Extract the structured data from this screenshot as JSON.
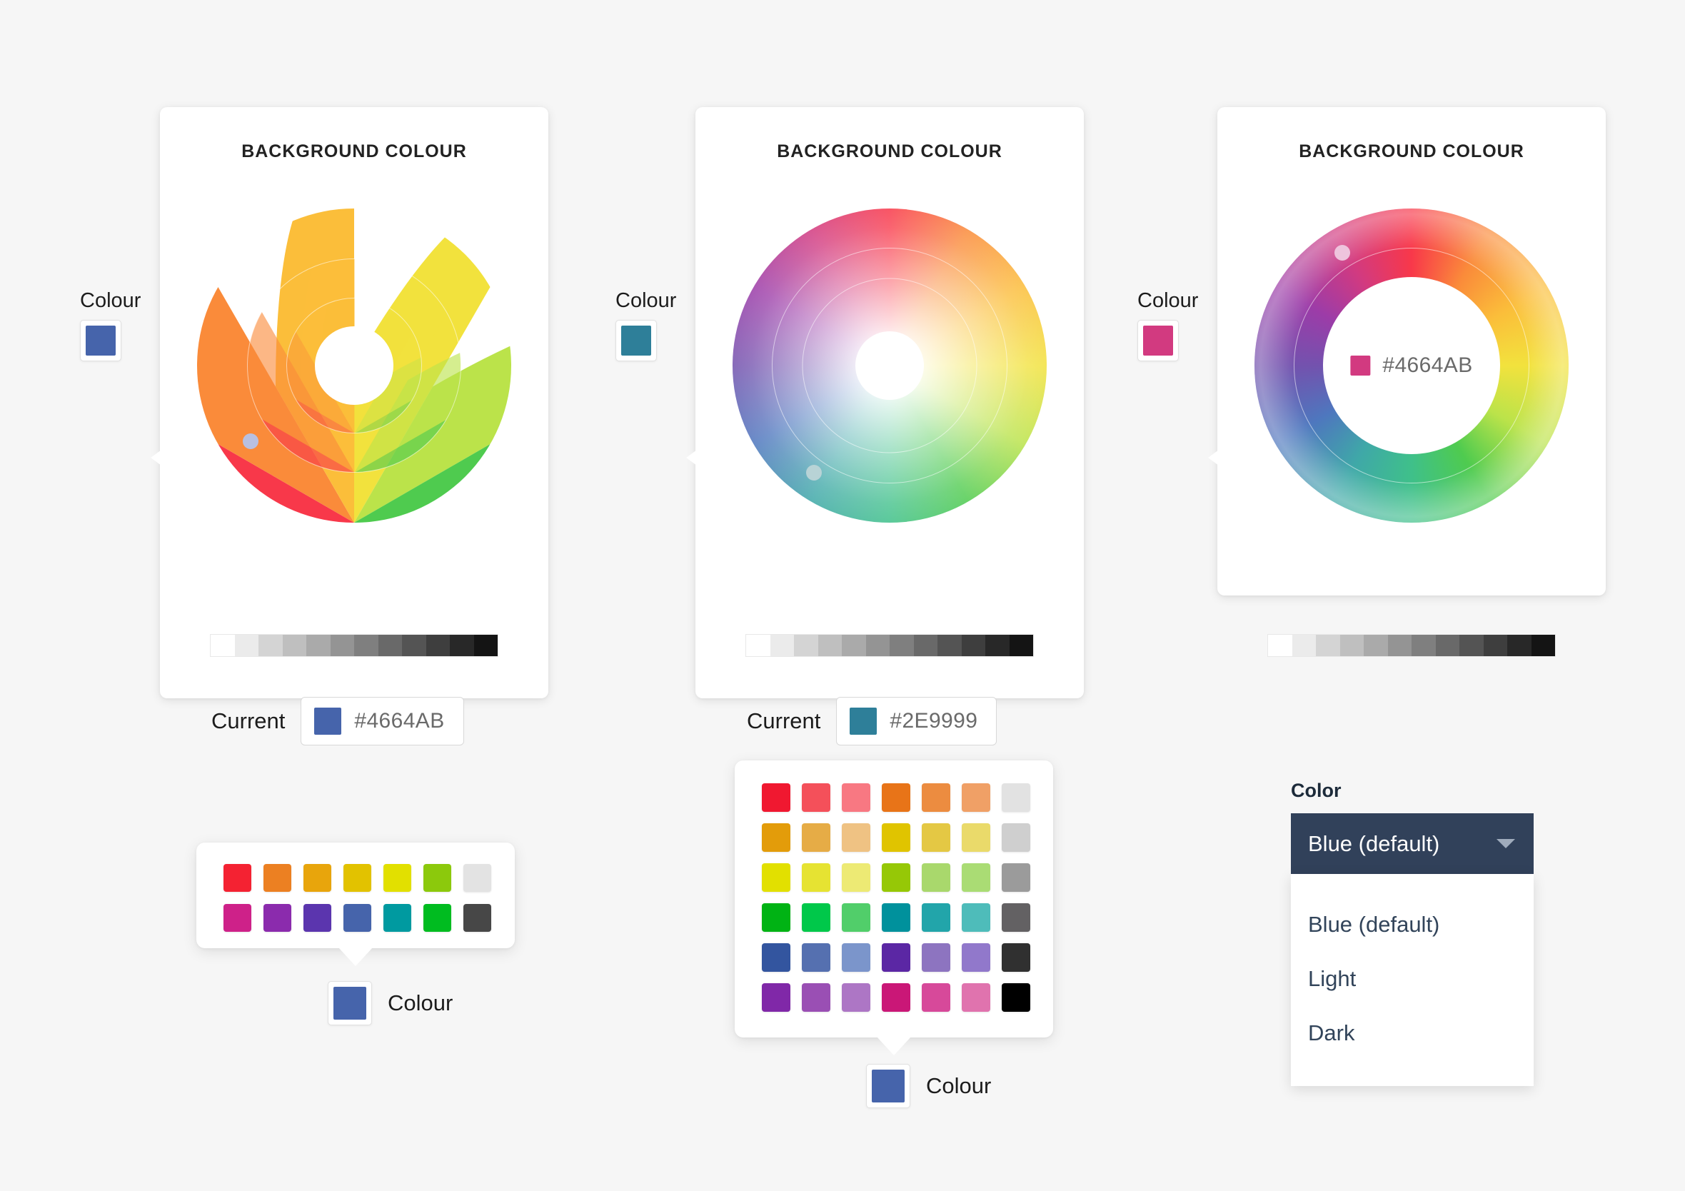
{
  "page": {
    "background": "#f6f6f6"
  },
  "cards": [
    {
      "title": "BACKGROUND COLOUR",
      "wheel_type": "segmented",
      "launcher": {
        "label": "Colour",
        "swatch_color": "#4664AB"
      },
      "selection_dot_color": "#b9c0e0",
      "greyscale": [
        "#ffffff",
        "#ebebeb",
        "#d4d4d4",
        "#bfbfbf",
        "#aaaaaa",
        "#949494",
        "#7f7f7f",
        "#696969",
        "#545454",
        "#3e3e3e",
        "#282828",
        "#141414"
      ],
      "current": {
        "label": "Current",
        "swatch_color": "#4664AB",
        "hex": "#4664AB"
      }
    },
    {
      "title": "BACKGROUND COLOUR",
      "wheel_type": "continuous",
      "launcher": {
        "label": "Colour",
        "swatch_color": "#2E7F99"
      },
      "selection_dot_color": "#b8d3d6",
      "greyscale": [
        "#ffffff",
        "#ebebeb",
        "#d4d4d4",
        "#bfbfbf",
        "#aaaaaa",
        "#949494",
        "#7f7f7f",
        "#696969",
        "#545454",
        "#3e3e3e",
        "#282828",
        "#141414"
      ],
      "current": {
        "label": "Current",
        "swatch_color": "#2E7F99",
        "hex": "#2E9999"
      }
    },
    {
      "title": "BACKGROUND COLOUR",
      "wheel_type": "donut",
      "launcher": {
        "label": "Colour",
        "swatch_color": "#D23A80"
      },
      "selection_dot_color": "#eec4dd",
      "greyscale": [
        "#ffffff",
        "#ebebeb",
        "#d4d4d4",
        "#bfbfbf",
        "#aaaaaa",
        "#949494",
        "#7f7f7f",
        "#696969",
        "#545454",
        "#3e3e3e",
        "#282828",
        "#141414"
      ],
      "center_readout": {
        "swatch_color": "#D23A80",
        "hex": "#4664AB"
      }
    }
  ],
  "small_palette": {
    "columns": 7,
    "rows": 2,
    "colors": [
      "#F42232",
      "#EC8022",
      "#E8A50C",
      "#E2C200",
      "#E2E000",
      "#8CC90C",
      "#E3E3E3",
      "#CE2189",
      "#8B2BAD",
      "#5B35AE",
      "#4664AB",
      "#009AA0",
      "#00BC20",
      "#474747"
    ],
    "anchor": {
      "label": "Colour",
      "swatch_color": "#4664AB"
    }
  },
  "large_palette": {
    "columns": 7,
    "rows": 6,
    "colors": [
      "#F01830",
      "#F4505A",
      "#F87882",
      "#E87418",
      "#EC8C40",
      "#F0A066",
      "#E2E2E2",
      "#E39C0A",
      "#E6AC46",
      "#EFC283",
      "#E0C400",
      "#E4C844",
      "#EADA6A",
      "#CFCFCF",
      "#E2E000",
      "#E6E332",
      "#EDEA74",
      "#96C806",
      "#A9D86C",
      "#AADC74",
      "#9B9B9B",
      "#00B314",
      "#00C84A",
      "#51CE6A",
      "#00919C",
      "#22A5AA",
      "#4EBCBA",
      "#636163",
      "#33559F",
      "#5570B0",
      "#7B95CB",
      "#5B27A4",
      "#8D74C0",
      "#9178CB",
      "#303030",
      "#8028A8",
      "#9A4FB4",
      "#AD76C5",
      "#CA1777",
      "#D7499A",
      "#E073AE",
      "#000000"
    ],
    "anchor": {
      "label": "Colour",
      "swatch_color": "#4664AB"
    }
  },
  "select": {
    "label": "Color",
    "value": "Blue (default)",
    "caret_icon": "chevron-down-icon",
    "options": [
      "Blue (default)",
      "Light",
      "Dark"
    ]
  },
  "wheel_hues": [
    "#F8384A",
    "#FA8B3A",
    "#FBBE3A",
    "#F2E23D",
    "#BBE34A",
    "#4FCB4F",
    "#3FC08A",
    "#3FA8A8",
    "#4E77BE",
    "#7352AE",
    "#9C3CA8",
    "#D23A80"
  ]
}
